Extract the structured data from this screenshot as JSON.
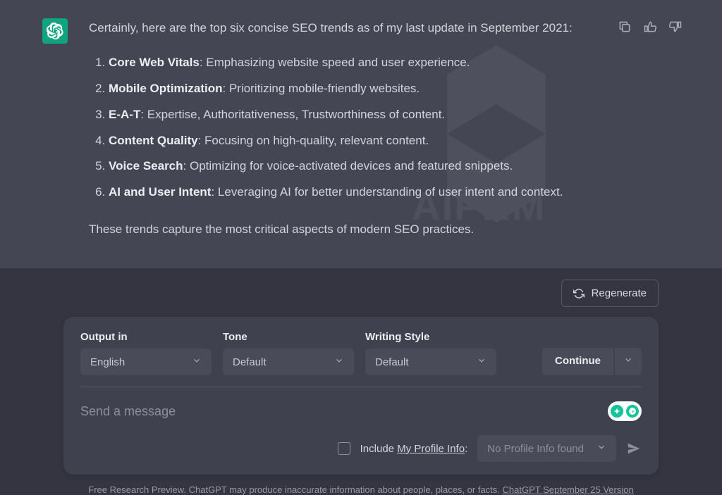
{
  "response": {
    "intro": "Certainly, here are the top six concise SEO trends as of my last update in September 2021:",
    "items": [
      {
        "title": "Core Web Vitals",
        "desc": ": Emphasizing website speed and user experience."
      },
      {
        "title": "Mobile Optimization",
        "desc": ": Prioritizing mobile-friendly websites."
      },
      {
        "title": "E-A-T",
        "desc": ": Expertise, Authoritativeness, Trustworthiness of content."
      },
      {
        "title": "Content Quality",
        "desc": ": Focusing on high-quality, relevant content."
      },
      {
        "title": "Voice Search",
        "desc": ": Optimizing for voice-activated devices and featured snippets."
      },
      {
        "title": "AI and User Intent",
        "desc": ": Leveraging AI for better understanding of user intent and context."
      }
    ],
    "outro": "These trends capture the most critical aspects of modern SEO practices."
  },
  "regenerate_label": "Regenerate",
  "selectors": {
    "output_label": "Output in",
    "output_value": "English",
    "tone_label": "Tone",
    "tone_value": "Default",
    "style_label": "Writing Style",
    "style_value": "Default"
  },
  "continue_label": "Continue",
  "message_placeholder": "Send a message",
  "profile": {
    "include_prefix": "Include ",
    "include_link": "My Profile Info",
    "include_suffix": ":",
    "select_value": "No Profile Info found"
  },
  "footer": {
    "text": "Free Research Preview. ChatGPT may produce inaccurate information about people, places, or facts. ",
    "link": "ChatGPT September 25 Version"
  },
  "watermark_text": "AIPRM"
}
